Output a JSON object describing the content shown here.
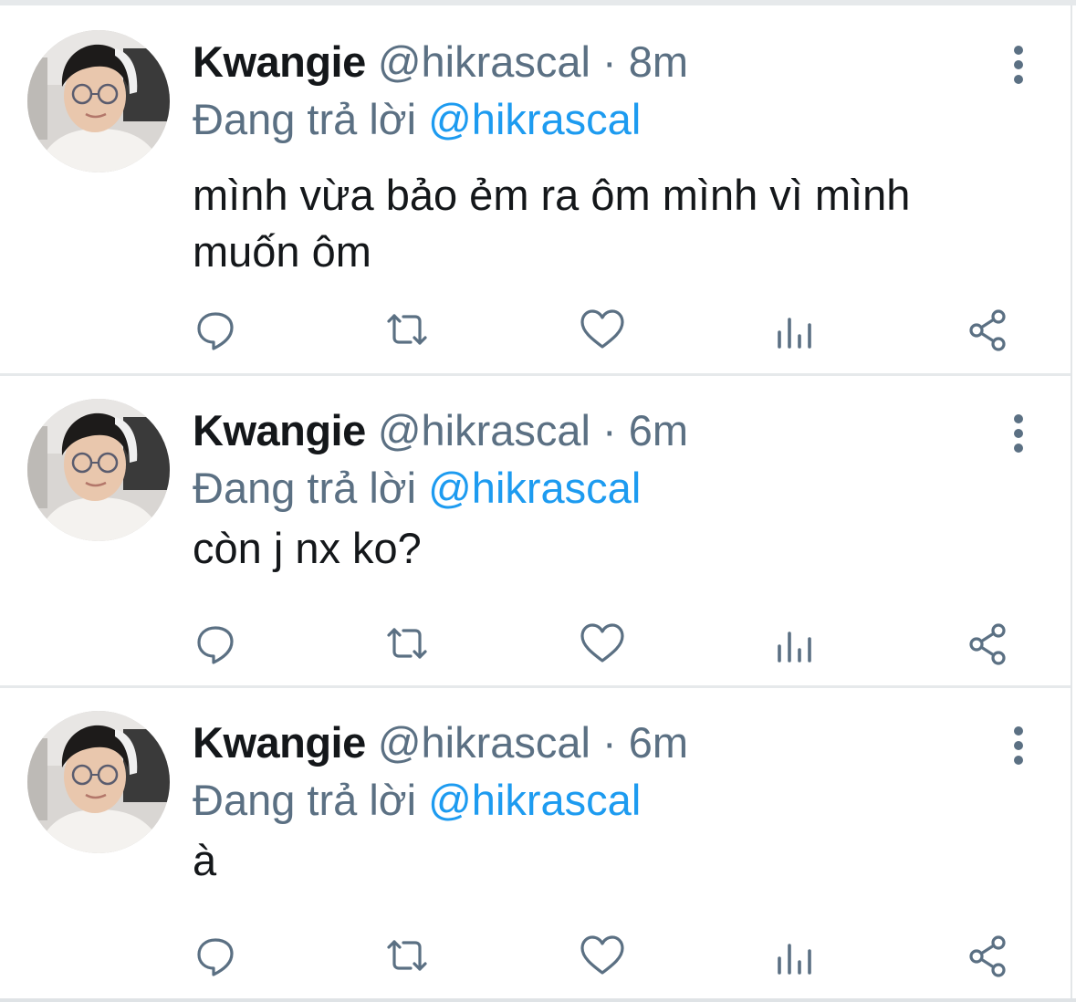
{
  "icon_color": "#5b7083",
  "mention_color": "#1d9bf0",
  "tweets": [
    {
      "name": "Kwangie",
      "handle": "@hikrascal",
      "sep": " · ",
      "time": "8m",
      "replying_prefix": "Đang trả lời ",
      "replying_to": "@hikrascal",
      "text": "mình vừa bảo ẻm ra ôm mình vì mình muốn ôm",
      "icons": [
        "reply-icon",
        "retweet-icon",
        "like-icon",
        "analytics-icon",
        "share-icon"
      ]
    },
    {
      "name": "Kwangie",
      "handle": "@hikrascal",
      "sep": " · ",
      "time": "6m",
      "replying_prefix": "Đang trả lời ",
      "replying_to": "@hikrascal",
      "text": "còn j nx ko?",
      "icons": [
        "reply-icon",
        "retweet-icon",
        "like-icon",
        "analytics-icon",
        "share-icon"
      ]
    },
    {
      "name": "Kwangie",
      "handle": "@hikrascal",
      "sep": " · ",
      "time": "6m",
      "replying_prefix": "Đang trả lời ",
      "replying_to": "@hikrascal",
      "text": "à",
      "icons": [
        "reply-icon",
        "retweet-icon",
        "like-icon",
        "analytics-icon",
        "share-icon"
      ]
    }
  ]
}
